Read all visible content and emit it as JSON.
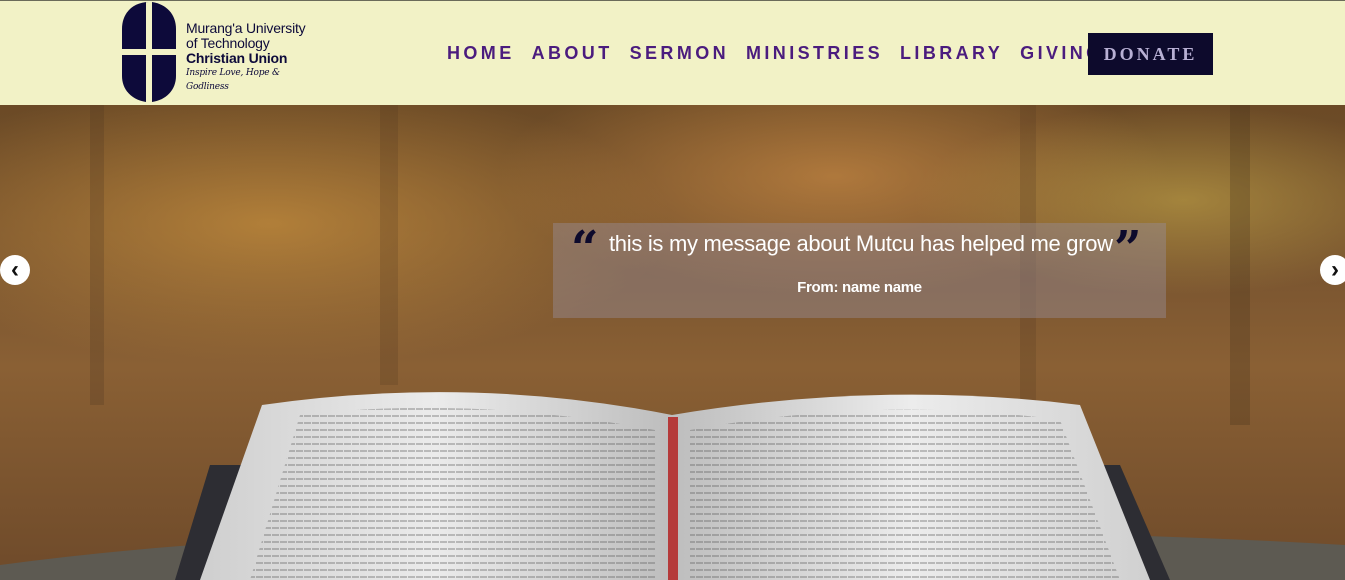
{
  "logo": {
    "line1": "Murang'a University",
    "line2": "of Technology",
    "line3": "Christian Union",
    "tagline": "Inspire Love, Hope & Godliness"
  },
  "nav": {
    "items": [
      {
        "label": "HOME"
      },
      {
        "label": "ABOUT"
      },
      {
        "label": "SERMON"
      },
      {
        "label": "MINISTRIES"
      },
      {
        "label": "LIBRARY"
      },
      {
        "label": "GIVING"
      }
    ],
    "donate_label": "DONATE"
  },
  "hero": {
    "quote": "this is my message about Mutcu has helped me grow",
    "from": "From: name name",
    "prev_icon": "chevron-left-icon",
    "next_icon": "chevron-right-icon"
  },
  "colors": {
    "header_bg": "#f2f2c6",
    "nav_text": "#4b1c7e",
    "donate_bg": "#0d0a2c",
    "logo_navy": "#0d0a3a"
  }
}
